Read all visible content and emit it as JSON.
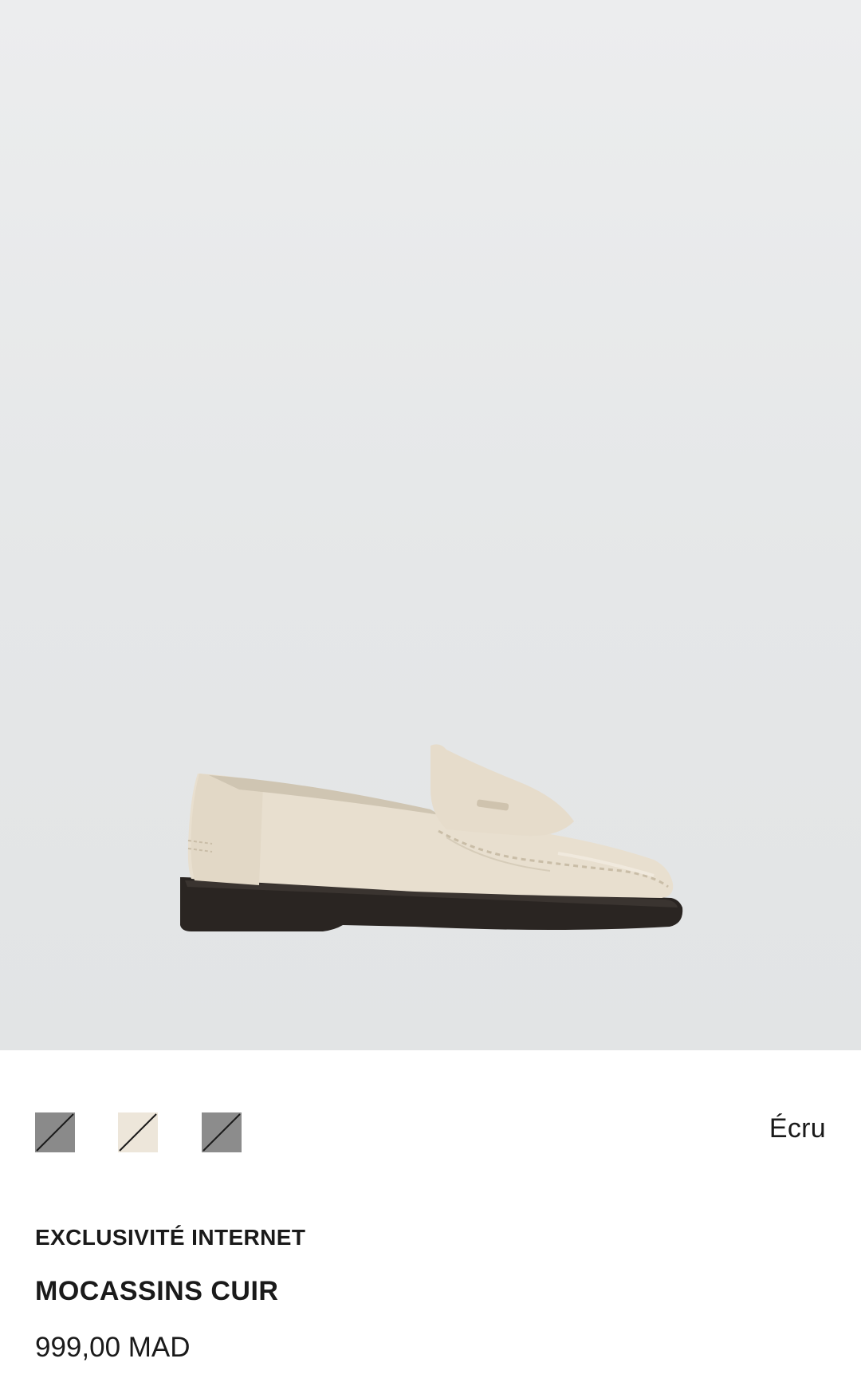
{
  "product": {
    "image_alt_icon": "loafer-shoe-image",
    "selected_color_name": "Écru",
    "exclusive_label": "EXCLUSIVITÉ INTERNET",
    "title": "MOCASSINS CUIR",
    "price": "999,00 MAD"
  },
  "swatches": [
    {
      "color": "#8a8a8a",
      "selected": false
    },
    {
      "color": "#ede6da",
      "selected": true
    },
    {
      "color": "#8c8c8c",
      "selected": false
    }
  ],
  "colors": {
    "background": "#ffffff",
    "image_background": "#e6e8e9",
    "text": "#1a1a1a",
    "shoe_upper": "#e8dfcf",
    "shoe_sole": "#2a2522"
  }
}
